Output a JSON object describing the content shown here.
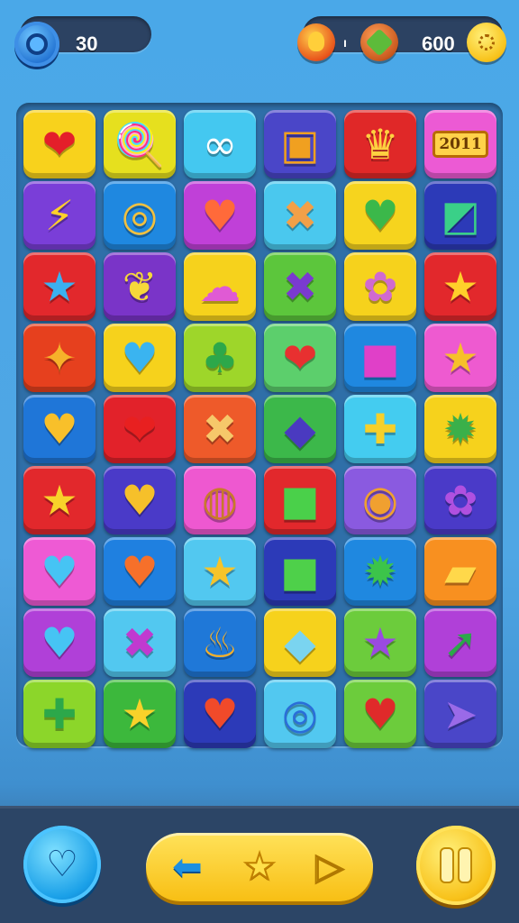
{
  "hud": {
    "left_value": "30",
    "right_small": "ı",
    "right_value": "600",
    "icons": [
      "gear-icon",
      "fire-icon",
      "leaf-icon",
      "sun-icon"
    ]
  },
  "board": {
    "rows": 9,
    "cols": 6,
    "tiles": [
      {
        "bg": "#f8d21c",
        "sym": "❤",
        "color": "#e41e2a"
      },
      {
        "bg": "#e6e01e",
        "sym": "🍭",
        "color": "#8a3ad8"
      },
      {
        "bg": "#44c8f0",
        "sym": "∞",
        "color": "#ffffff"
      },
      {
        "bg": "#4a46c8",
        "sym": "▣",
        "color": "#f0a020"
      },
      {
        "bg": "#e02828",
        "sym": "♛",
        "color": "#ffd040"
      },
      {
        "bg": "#ec5ad4",
        "text": "2011"
      },
      {
        "bg": "#7a3ed8",
        "sym": "⚡",
        "color": "#ffd02a"
      },
      {
        "bg": "#1f88e0",
        "sym": "◎",
        "color": "#f0c040"
      },
      {
        "bg": "#c040d8",
        "sym": "♥",
        "color": "#ff6a3a"
      },
      {
        "bg": "#4ac8ee",
        "sym": "✖",
        "color": "#f2a048"
      },
      {
        "bg": "#f6d41e",
        "sym": "♥",
        "color": "#3bb84a"
      },
      {
        "bg": "#2c3ab8",
        "sym": "◩",
        "color": "#3ad088"
      },
      {
        "bg": "#e2282c",
        "sym": "★",
        "color": "#3ab0f0"
      },
      {
        "bg": "#7a34c8",
        "sym": "❦",
        "color": "#f6d83a"
      },
      {
        "bg": "#f6d21c",
        "sym": "☁",
        "color": "#e05ad4"
      },
      {
        "bg": "#5cc63c",
        "sym": "✖",
        "color": "#7a3ad0"
      },
      {
        "bg": "#f6d21c",
        "sym": "✿",
        "color": "#d06ad0"
      },
      {
        "bg": "#e2282c",
        "sym": "★",
        "color": "#ffd02a"
      },
      {
        "bg": "#e6401e",
        "sym": "✦",
        "color": "#f6b22a"
      },
      {
        "bg": "#f6d21c",
        "sym": "♥",
        "color": "#3ab4f0"
      },
      {
        "bg": "#9ed62a",
        "sym": "♣",
        "color": "#2ca84a"
      },
      {
        "bg": "#5ccf6c",
        "sym": "❤",
        "color": "#e83030"
      },
      {
        "bg": "#1f88e0",
        "sym": "■",
        "color": "#e040c8"
      },
      {
        "bg": "#ee5ad0",
        "sym": "★",
        "color": "#f6c02a"
      },
      {
        "bg": "#1f76d8",
        "sym": "♥",
        "color": "#f8c02a"
      },
      {
        "bg": "#e2222a",
        "sym": "❤",
        "color": "#e82020"
      },
      {
        "bg": "#ee5a2a",
        "sym": "✖",
        "color": "#f6c86a"
      },
      {
        "bg": "#3cb84a",
        "sym": "◆",
        "color": "#4a3ac0"
      },
      {
        "bg": "#44ccf0",
        "sym": "✚",
        "color": "#f6d02a"
      },
      {
        "bg": "#f6d21c",
        "sym": "✹",
        "color": "#3ab04a"
      },
      {
        "bg": "#e2282c",
        "sym": "★",
        "color": "#f8d22a"
      },
      {
        "bg": "#4a3ac8",
        "sym": "♥",
        "color": "#f6c02a"
      },
      {
        "bg": "#ee58d0",
        "sym": "◍",
        "color": "#c87a2a"
      },
      {
        "bg": "#e2282c",
        "sym": "■",
        "color": "#4ad04a"
      },
      {
        "bg": "#8a5ae0",
        "sym": "◉",
        "color": "#f0a030"
      },
      {
        "bg": "#4a3ac8",
        "sym": "✿",
        "color": "#b050e0"
      },
      {
        "bg": "#ee5ad4",
        "sym": "♥",
        "color": "#46c4f4"
      },
      {
        "bg": "#1f80e0",
        "sym": "♥",
        "color": "#f6702a"
      },
      {
        "bg": "#52c8f0",
        "sym": "★",
        "color": "#f6c42a"
      },
      {
        "bg": "#2c3ab8",
        "sym": "■",
        "color": "#4ed04a"
      },
      {
        "bg": "#1f88e0",
        "sym": "✹",
        "color": "#3cc44a"
      },
      {
        "bg": "#f89020",
        "sym": "▰",
        "color": "#ffd84a"
      },
      {
        "bg": "#b040d8",
        "sym": "♥",
        "color": "#46c4f4"
      },
      {
        "bg": "#52c8f0",
        "sym": "✖",
        "color": "#c03ad0"
      },
      {
        "bg": "#1f78d8",
        "sym": "♨",
        "color": "#f6b02a"
      },
      {
        "bg": "#f6d21c",
        "sym": "◆",
        "color": "#7ad4f0"
      },
      {
        "bg": "#6ccc3c",
        "sym": "★",
        "color": "#9a4ae0"
      },
      {
        "bg": "#b040d8",
        "sym": "➚",
        "color": "#2ca84a"
      },
      {
        "bg": "#8cd62a",
        "sym": "✚",
        "color": "#2ca84a"
      },
      {
        "bg": "#3cb83c",
        "sym": "★",
        "color": "#f8d22a"
      },
      {
        "bg": "#2c3ab8",
        "sym": "♥",
        "color": "#f04a2a"
      },
      {
        "bg": "#52c8f0",
        "sym": "◎",
        "color": "#2a6ed8"
      },
      {
        "bg": "#6ccc3c",
        "sym": "♥",
        "color": "#e02a2a"
      },
      {
        "bg": "#4a46c8",
        "sym": "➤",
        "color": "#9a6ae8"
      }
    ]
  },
  "controls": {
    "left_button_icon": "♡",
    "back_icon": "⬅",
    "star_icon": "★",
    "next_icon": "▷"
  }
}
